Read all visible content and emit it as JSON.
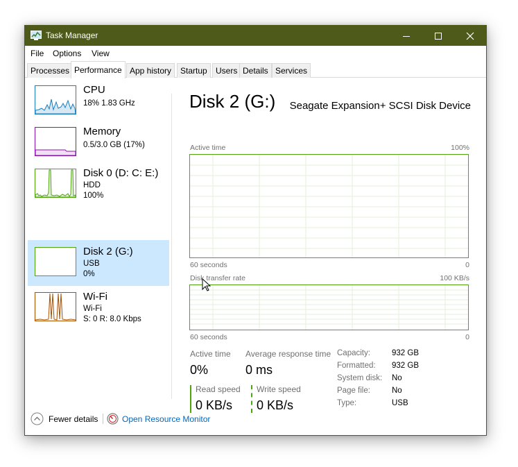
{
  "window": {
    "title": "Task Manager"
  },
  "menu": [
    "File",
    "Options",
    "View"
  ],
  "tabs": [
    "Processes",
    "Performance",
    "App history",
    "Startup",
    "Users",
    "Details",
    "Services"
  ],
  "sidebar": [
    {
      "title": "CPU",
      "line1": "18% 1.83 GHz",
      "line2": "",
      "color": "#1a7dc0"
    },
    {
      "title": "Memory",
      "line1": "0.5/3.0 GB (17%)",
      "line2": "",
      "color": "#8b12ae"
    },
    {
      "title": "Disk 0 (D: C: E:)",
      "line1": "HDD",
      "line2": "100%",
      "color": "#4da60c"
    },
    {
      "title": "Disk 2 (G:)",
      "line1": "USB",
      "line2": "0%",
      "color": "#4da60c",
      "selected": true
    },
    {
      "title": "Wi-Fi",
      "line1": "Wi-Fi",
      "line2": "S: 0 R: 8.0 Kbps",
      "color": "#a74f01"
    }
  ],
  "main": {
    "title": "Disk 2 (G:)",
    "device": "Seagate Expansion+ SCSI Disk Device",
    "graph1": {
      "label": "Active time",
      "max": "100%",
      "time": "60 seconds",
      "min": "0"
    },
    "graph2": {
      "label": "Disk transfer rate",
      "max": "100 KB/s",
      "time": "60 seconds",
      "min": "0"
    },
    "stats": {
      "active_time_label": "Active time",
      "active_time": "0%",
      "response_label": "Average response time",
      "response": "0 ms",
      "read_label": "Read speed",
      "read": "0 KB/s",
      "write_label": "Write speed",
      "write": "0 KB/s"
    },
    "properties": [
      {
        "label": "Capacity:",
        "value": "932 GB"
      },
      {
        "label": "Formatted:",
        "value": "932 GB"
      },
      {
        "label": "System disk:",
        "value": "No"
      },
      {
        "label": "Page file:",
        "value": "No"
      },
      {
        "label": "Type:",
        "value": "USB"
      }
    ]
  },
  "footer": {
    "fewer": "Fewer details",
    "monitor": "Open Resource Monitor"
  },
  "colors": {
    "titlebar": "#4d5a1a",
    "disk_green": "#4da60c",
    "selected_bg": "#cce8ff",
    "link": "#0a65b4"
  }
}
